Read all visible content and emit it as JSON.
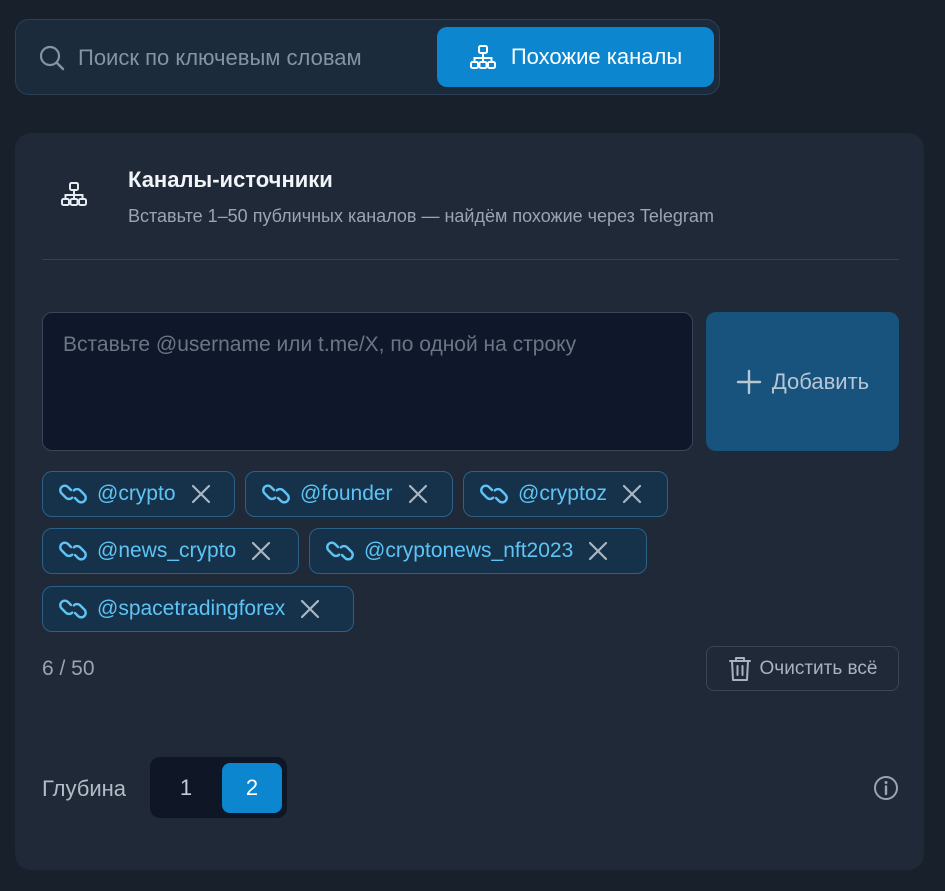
{
  "mode_switch": {
    "search_label": "Поиск по ключевым словам",
    "similar_label": "Похожие каналы",
    "active": "similar"
  },
  "sources_card": {
    "title": "Каналы-источники",
    "subtitle": "Вставьте 1–50 публичных каналов — найдём похожие через Telegram",
    "input_placeholder": "Вставьте @username или t.me/X, по одной на строку",
    "input_value": "",
    "add_label": "Добавить"
  },
  "channels": [
    {
      "label": "@crypto"
    },
    {
      "label": "@founder"
    },
    {
      "label": "@cryptoz"
    },
    {
      "label": "@news_crypto"
    },
    {
      "label": "@cryptonews_nft2023"
    },
    {
      "label": "@spacetradingforex"
    }
  ],
  "counter": "6 / 50",
  "clear_label": "Очистить всё",
  "depth": {
    "label": "Глубина",
    "options": [
      "1",
      "2"
    ],
    "selected": "2"
  },
  "colors": {
    "accent": "#0b86cf",
    "chip_text": "#5dc4f5",
    "background": "#18202c",
    "card": "#1f2937"
  },
  "icons": {
    "search": "search-icon",
    "similar": "hierarchy-icon",
    "chip": "link-icon",
    "remove": "close-icon",
    "add": "plus-icon",
    "clear": "trash-icon",
    "info": "info-icon"
  }
}
